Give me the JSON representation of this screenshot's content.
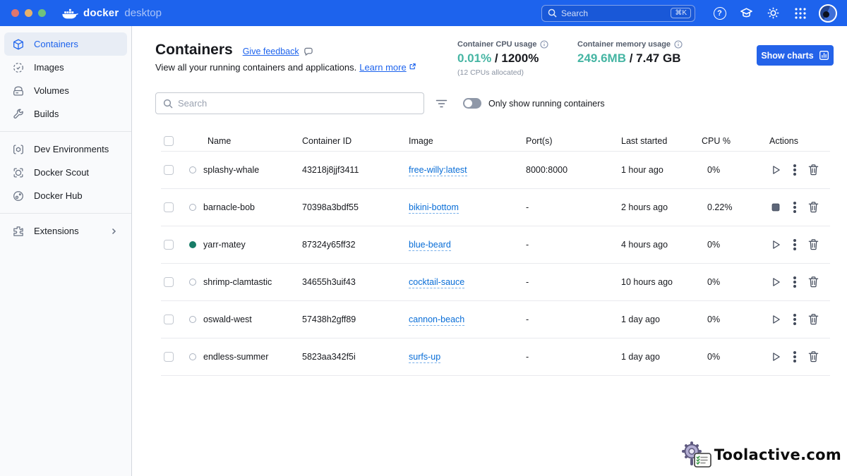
{
  "colors": {
    "topbar_blue": "#1d63ed",
    "accent_blue": "#2463e9",
    "link_blue": "#086dd7",
    "metric_teal": "#45b5a3",
    "running_dot_green": "#177c67"
  },
  "titlebar": {
    "logo_bold": "docker",
    "logo_light": "desktop",
    "search": {
      "placeholder": "Search",
      "shortcut": "⌘K"
    }
  },
  "sidebar": {
    "items": [
      {
        "label": "Containers",
        "active": true
      },
      {
        "label": "Images"
      },
      {
        "label": "Volumes"
      },
      {
        "label": "Builds"
      },
      {
        "label": "Dev Environments"
      },
      {
        "label": "Docker Scout"
      },
      {
        "label": "Docker Hub"
      },
      {
        "label": "Extensions"
      }
    ]
  },
  "header": {
    "title": "Containers",
    "feedback_link": "Give feedback",
    "subtitle": "View all your running containers and applications.",
    "learn_more": "Learn more",
    "cpu": {
      "label": "Container CPU usage",
      "used": "0.01%",
      "sep": " / ",
      "total": "1200%",
      "note": "(12 CPUs allocated)"
    },
    "memory": {
      "label": "Container memory usage",
      "used": "249.6MB",
      "sep": " / ",
      "total": "7.47 GB"
    },
    "show_charts_label": "Show charts"
  },
  "toolbar": {
    "search_placeholder": "Search",
    "toggle_label": "Only show running containers"
  },
  "table": {
    "headers": [
      "Name",
      "Container ID",
      "Image",
      "Port(s)",
      "Last started",
      "CPU %",
      "Actions"
    ],
    "rows": [
      {
        "name": "splashy-whale",
        "container_id": "43218j8jjf3411",
        "image": "free-willy:latest",
        "ports": "8000:8000",
        "last_started": "1 hour ago",
        "cpu": "0%",
        "running": false,
        "action": "play"
      },
      {
        "name": "barnacle-bob",
        "container_id": "70398a3bdf55",
        "image": "bikini-bottom",
        "ports": "-",
        "last_started": "2 hours ago",
        "cpu": "0.22%",
        "running": false,
        "action": "stop"
      },
      {
        "name": "yarr-matey",
        "container_id": "87324y65ff32",
        "image": "blue-beard",
        "ports": "-",
        "last_started": "4 hours ago",
        "cpu": "0%",
        "running": true,
        "action": "play"
      },
      {
        "name": "shrimp-clamtastic",
        "container_id": "34655h3uif43",
        "image": "cocktail-sauce",
        "ports": "-",
        "last_started": "10 hours ago",
        "cpu": "0%",
        "running": false,
        "action": "play"
      },
      {
        "name": "oswald-west",
        "container_id": "57438h2gff89",
        "image": "cannon-beach",
        "ports": "-",
        "last_started": "1 day ago",
        "cpu": "0%",
        "running": false,
        "action": "play"
      },
      {
        "name": "endless-summer",
        "container_id": "5823aa342f5i",
        "image": "surfs-up",
        "ports": "-",
        "last_started": "1 day ago",
        "cpu": "0%",
        "running": false,
        "action": "play"
      }
    ]
  },
  "icons": {
    "traffic_lights": "red-yellow-green window dots",
    "whale-logo-icon": "docker whale",
    "search-icon": "magnifier",
    "help-icon": "? in circle",
    "learning-center-icon": "graduation cap",
    "settings-icon": "gear",
    "apps-grid-icon": "3x3 dots",
    "feedback-icon": "speech bubble",
    "external-link-icon": "box with arrow",
    "info-icon": "i in circle",
    "bar-chart-icon": "bars in square",
    "filter-icon": "three shrinking lines",
    "play-icon": "triangle outline",
    "stop-icon": "filled square",
    "kebab-icon": "vertical dots",
    "trash-icon": "trash can outline"
  },
  "watermark": {
    "text": "Toolactive.com"
  }
}
